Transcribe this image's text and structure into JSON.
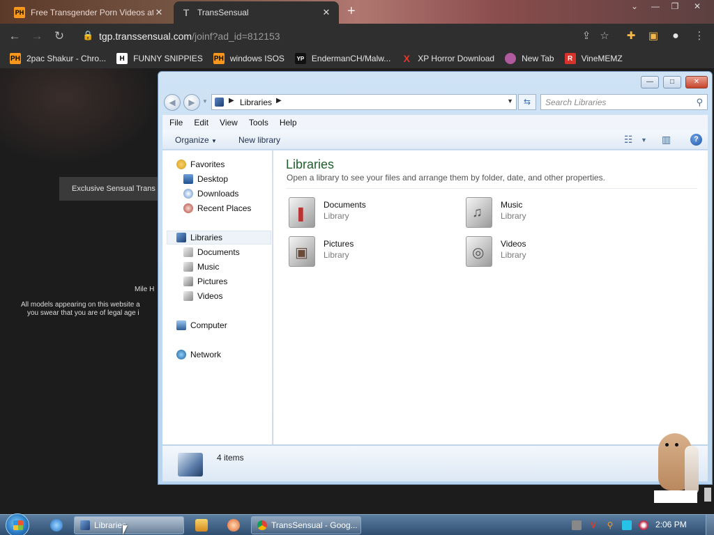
{
  "browser": {
    "tabs": [
      {
        "favicon": "PH",
        "title": "Free Transgender Porn Videos at"
      },
      {
        "favicon": "T",
        "title": "TransSensual"
      }
    ],
    "new_tab": "+",
    "url_host": "tgp.transsensual.com",
    "url_path": "/joinf?ad_id=812153",
    "bookmarks": [
      {
        "icon": "PH",
        "label": "2pac Shakur - Chro...",
        "color": "#f7971d"
      },
      {
        "icon": "H",
        "label": "FUNNY SNIPPIES",
        "color": "#ffffff"
      },
      {
        "icon": "PH",
        "label": "windows ISOS",
        "color": "#f7971d"
      },
      {
        "icon": "YP",
        "label": "EndermanCH/Malw...",
        "color": "#111111"
      },
      {
        "icon": "X",
        "label": "XP Horror Download",
        "color": "#e03a2f"
      },
      {
        "icon": "",
        "label": "New Tab",
        "color": "#b05aa0"
      },
      {
        "icon": "R",
        "label": "VineMEMZ",
        "color": "#d8332b"
      }
    ]
  },
  "webpage": {
    "banner": "Exclusive Sensual Trans I",
    "small": "Mile H",
    "disclaimer_1": "All models appearing on this website a",
    "disclaimer_2": "you swear that you are of legal age i"
  },
  "explorer": {
    "controls": {
      "minimize": "—",
      "maximize": "□",
      "close": "✕"
    },
    "breadcrumb": "Libraries",
    "search_placeholder": "Search Libraries",
    "menu": [
      "File",
      "Edit",
      "View",
      "Tools",
      "Help"
    ],
    "commands": {
      "organize": "Organize",
      "new_library": "New library"
    },
    "nav": {
      "favorites": "Favorites",
      "favorites_items": [
        "Desktop",
        "Downloads",
        "Recent Places"
      ],
      "libraries": "Libraries",
      "libraries_items": [
        "Documents",
        "Music",
        "Pictures",
        "Videos"
      ],
      "computer": "Computer",
      "network": "Network"
    },
    "heading": "Libraries",
    "description": "Open a library to see your files and arrange them by folder, date, and other properties.",
    "libraries": [
      {
        "name": "Documents",
        "kind": "Library",
        "icon": "documents-library-icon"
      },
      {
        "name": "Music",
        "kind": "Library",
        "icon": "music-library-icon"
      },
      {
        "name": "Pictures",
        "kind": "Library",
        "icon": "pictures-library-icon"
      },
      {
        "name": "Videos",
        "kind": "Library",
        "icon": "videos-library-icon"
      }
    ],
    "status": "4 items"
  },
  "taskbar": {
    "tasks": [
      {
        "label": "Libraries"
      },
      {
        "label": "TransSensual - Goog..."
      }
    ],
    "clock": "2:06 PM"
  }
}
